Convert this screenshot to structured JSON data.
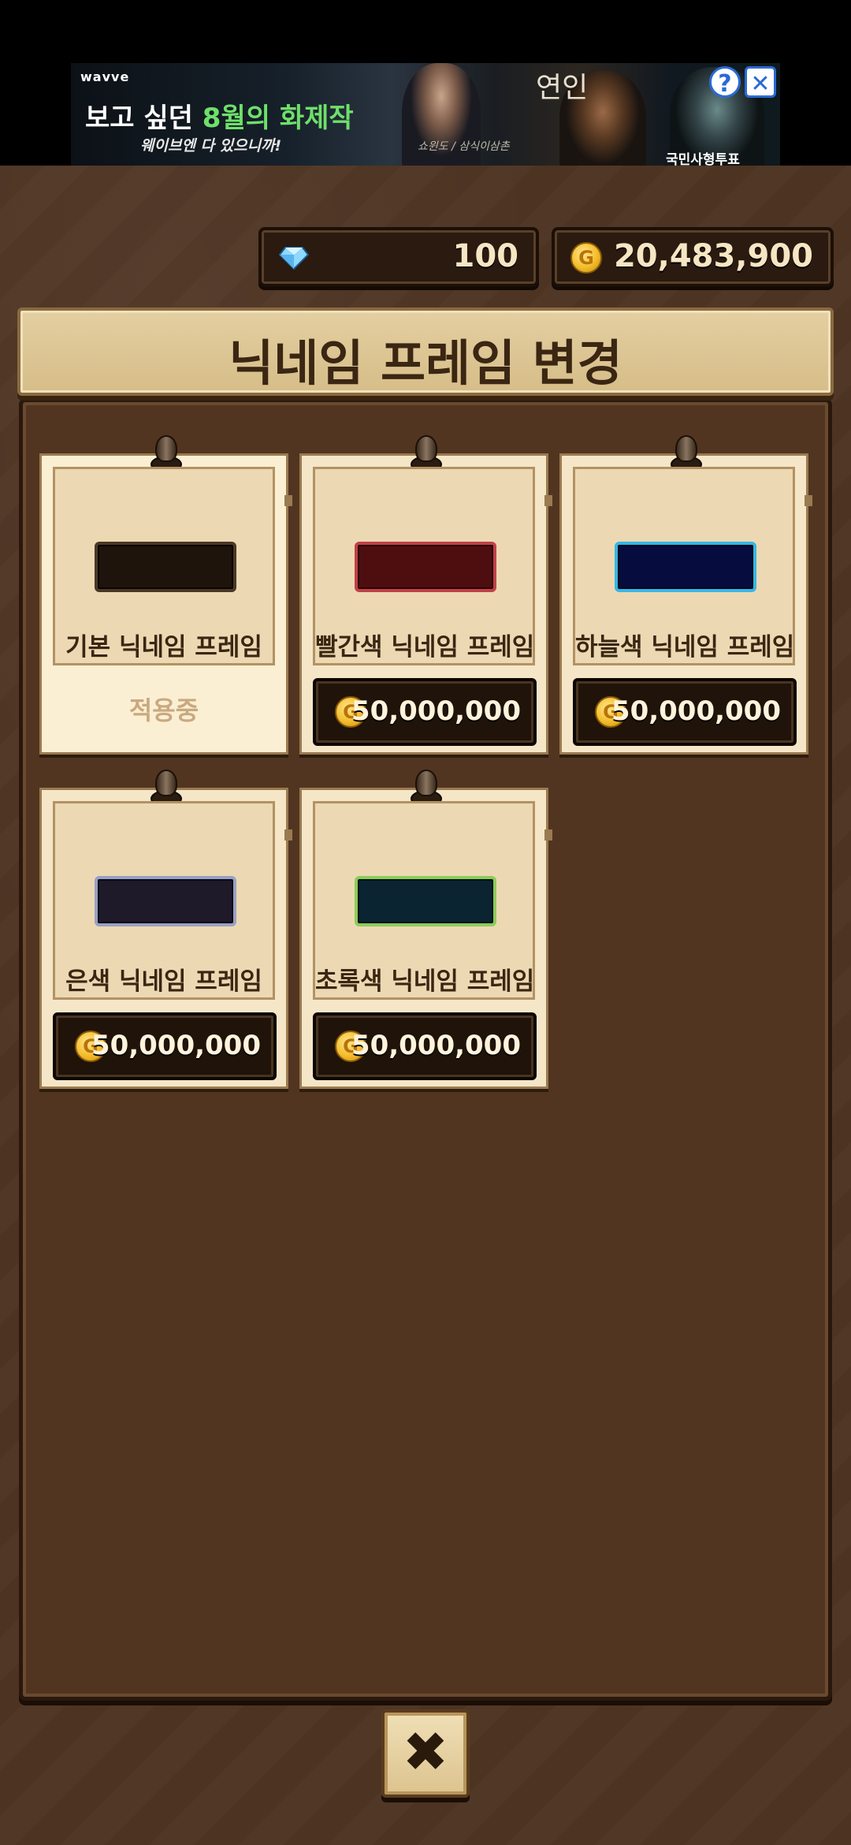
{
  "ad": {
    "brand": "wavve",
    "headline_prefix": "보고 싶던 ",
    "headline_highlight": "8월의 화제작",
    "subline": "웨이브엔 다 있으니까!",
    "show_title": "연인",
    "credit_left": "쇼윈도 / 삼식이삼촌",
    "credit_right": "국민사형투표",
    "help_label": "?",
    "close_label": "✕"
  },
  "currency": {
    "gems": "100",
    "gold": "20,483,900",
    "gem_icon": "diamond-icon",
    "gold_icon": "gold-coin-icon",
    "coin_letter": "G"
  },
  "panel": {
    "title": "닉네임 프레임 변경"
  },
  "frames": [
    {
      "label": "기본 닉네임 프레임",
      "status": "적용중",
      "fill": "#1e140c",
      "border": "#4a3826"
    },
    {
      "label": "빨간색 닉네임 프레임",
      "price": "50,000,000",
      "fill": "#4e0e10",
      "border": "#c04048"
    },
    {
      "label": "하늘색 닉네임 프레임",
      "price": "50,000,000",
      "fill": "#060c3e",
      "border": "#36b6e4"
    },
    {
      "label": "은색 닉네임 프레임",
      "price": "50,000,000",
      "fill": "#1e1a2a",
      "border": "#9aa0c4"
    },
    {
      "label": "초록색 닉네임 프레임",
      "price": "50,000,000",
      "fill": "#0a2432",
      "border": "#8ccc5a"
    }
  ],
  "close_button": {
    "icon": "close-icon",
    "label": "✖"
  },
  "colors": {
    "wood_bg": "#4f3523",
    "parchment": "#f5e6c8",
    "text_dark": "#3a2612",
    "status_muted": "#c9a980"
  }
}
